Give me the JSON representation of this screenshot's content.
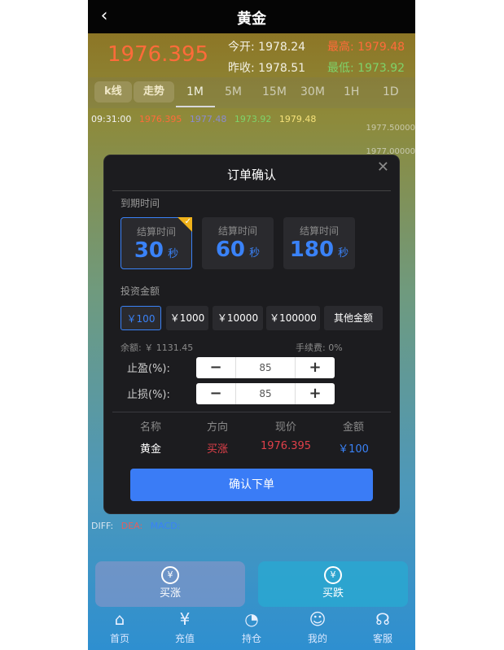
{
  "header": {
    "back_icon": "chevron-left-icon",
    "title": "黄金"
  },
  "quote": {
    "price": "1976.395",
    "open_label": "今开:",
    "open_value": "1978.24",
    "high_label": "最高:",
    "high_value": "1979.48",
    "prev_label": "昨收:",
    "prev_value": "1978.51",
    "low_label": "最低:",
    "low_value": "1973.92"
  },
  "tabs": [
    "k线",
    "走势",
    "1M",
    "5M",
    "15M",
    "30M",
    "1H",
    "1D"
  ],
  "chart": {
    "time": "09:31:00",
    "v1": "1976.395",
    "v2": "1977.48",
    "v3": "1973.92",
    "v4": "1979.48",
    "ylabels": [
      "1977.50000",
      "1977.00000"
    ]
  },
  "indicators": {
    "diff": "DIFF:",
    "dea": "DEA:",
    "macd": "MACD:"
  },
  "actions": {
    "buy_up": "买涨",
    "buy_down": "买跌"
  },
  "nav": [
    {
      "label": "首页",
      "icon": "home-icon"
    },
    {
      "label": "充值",
      "icon": "wallet-icon"
    },
    {
      "label": "持仓",
      "icon": "chart-icon"
    },
    {
      "label": "我的",
      "icon": "user-icon"
    },
    {
      "label": "客服",
      "icon": "headset-icon"
    }
  ],
  "modal": {
    "title": "订单确认",
    "close_icon": "close-icon",
    "expiry_label": "到期时间",
    "times": [
      {
        "label": "结算时间",
        "value": "30",
        "unit": "秒",
        "selected": true
      },
      {
        "label": "结算时间",
        "value": "60",
        "unit": "秒",
        "selected": false
      },
      {
        "label": "结算时间",
        "value": "180",
        "unit": "秒",
        "selected": false
      }
    ],
    "amount_label": "投资金额",
    "amounts": [
      "￥100",
      "￥1000",
      "￥10000",
      "￥100000",
      "其他金额"
    ],
    "balance": "余额: ￥ 1131.45",
    "fee": "手续费: 0%",
    "take_profit_label": "止盈(%):",
    "take_profit_value": "85",
    "stop_loss_label": "止损(%):",
    "stop_loss_value": "85",
    "table_headers": [
      "名称",
      "方向",
      "现价",
      "金额"
    ],
    "row": {
      "name": "黄金",
      "direction": "买涨",
      "price": "1976.395",
      "amount": "￥100"
    },
    "confirm": "确认下单",
    "accent": "#3a7cf6"
  }
}
